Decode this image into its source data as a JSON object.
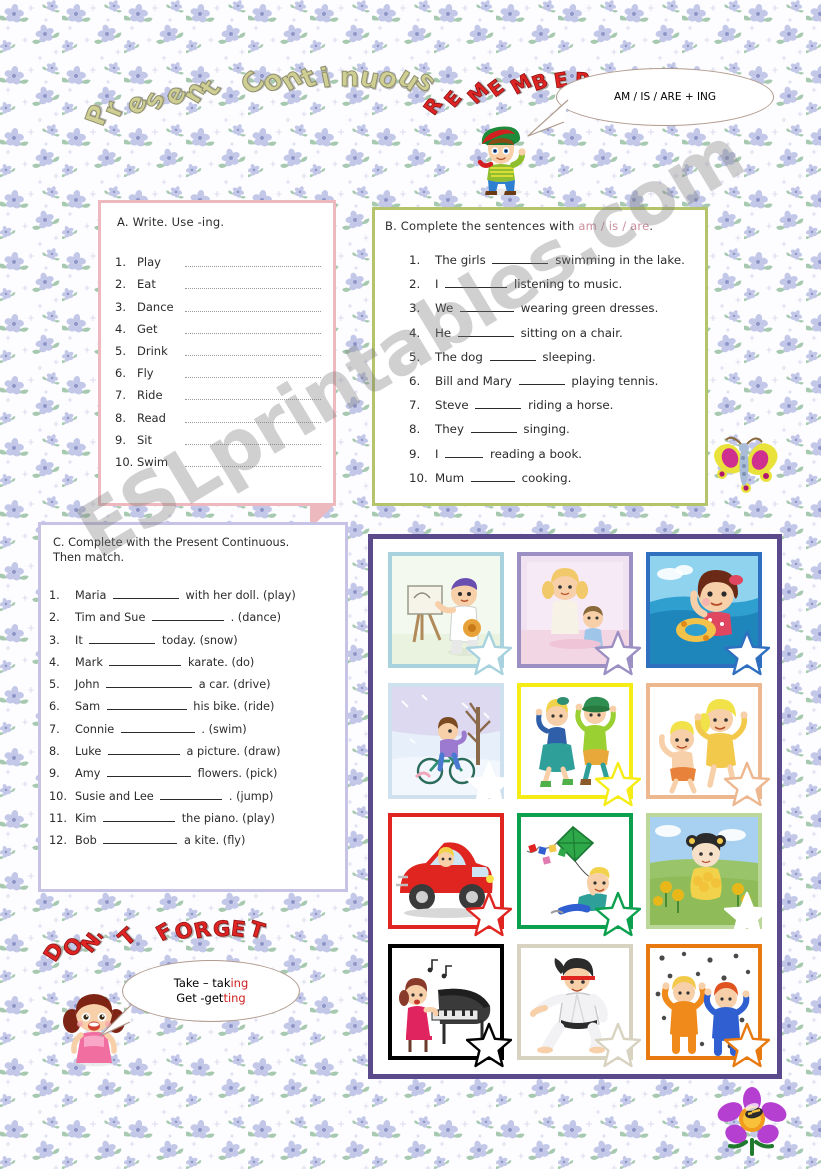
{
  "worksheet": {
    "title": "Present Continuous",
    "remember_title": "REMEMBER",
    "remember_rule": "AM / IS / ARE + ING",
    "forget_title": "DON'T FORGET",
    "forget_line1_a": "Take – tak",
    "forget_line1_b": "ing",
    "forget_line2_a": "Get -get",
    "forget_line2_b": "ting",
    "watermark": "ESLprintables.com"
  },
  "exercise_a": {
    "heading": "A.  Write. Use -ing.",
    "items": [
      {
        "num": "1.",
        "verb": "Play"
      },
      {
        "num": "2.",
        "verb": "Eat"
      },
      {
        "num": "3.",
        "verb": "Dance"
      },
      {
        "num": "4.",
        "verb": "Get"
      },
      {
        "num": "5.",
        "verb": "Drink"
      },
      {
        "num": "6.",
        "verb": "Fly"
      },
      {
        "num": "7.",
        "verb": "Ride"
      },
      {
        "num": "8.",
        "verb": "Read"
      },
      {
        "num": "9.",
        "verb": "Sit"
      },
      {
        "num": "10.",
        "verb": "Swim"
      }
    ]
  },
  "exercise_b": {
    "heading_before": "B. Complete the sentences with ",
    "heading_forms": "am / is / are",
    "heading_after": ".",
    "items": [
      {
        "num": "1.",
        "before": "The girls",
        "blank": 56,
        "after": "swimming in the lake."
      },
      {
        "num": "2.",
        "before": "I",
        "blank": 62,
        "after": "listening to music."
      },
      {
        "num": "3.",
        "before": "We",
        "blank": 54,
        "after": "wearing green dresses."
      },
      {
        "num": "4.",
        "before": "He",
        "blank": 56,
        "after": "sitting on a chair."
      },
      {
        "num": "5.",
        "before": "The dog",
        "blank": 46,
        "after": "sleeping."
      },
      {
        "num": "6.",
        "before": "Bill and Mary",
        "blank": 46,
        "after": "playing tennis."
      },
      {
        "num": "7.",
        "before": "Steve",
        "blank": 46,
        "after": "riding a horse."
      },
      {
        "num": "8.",
        "before": "They",
        "blank": 46,
        "after": "singing."
      },
      {
        "num": "9.",
        "before": "I",
        "blank": 38,
        "after": "reading a book."
      },
      {
        "num": "10.",
        "before": "Mum",
        "blank": 44,
        "after": "cooking."
      }
    ]
  },
  "exercise_c": {
    "heading_line1": "C. Complete with the Present Continuous.",
    "heading_line2": "Then match.",
    "items": [
      {
        "num": "1.",
        "before": "Maria",
        "blank": 66,
        "after": "with her doll. (play)"
      },
      {
        "num": "2.",
        "before": "Tim and Sue",
        "blank": 72,
        "after": ". (dance)"
      },
      {
        "num": "3.",
        "before": "It",
        "blank": 66,
        "after": "today. (snow)"
      },
      {
        "num": "4.",
        "before": "Mark",
        "blank": 72,
        "after": "karate. (do)"
      },
      {
        "num": "5.",
        "before": "John",
        "blank": 86,
        "after": "a car. (drive)"
      },
      {
        "num": "6.",
        "before": "Sam",
        "blank": 80,
        "after": "his bike. (ride)"
      },
      {
        "num": "7.",
        "before": "Connie",
        "blank": 74,
        "after": ". (swim)"
      },
      {
        "num": "8.",
        "before": "Luke",
        "blank": 72,
        "after": "a picture. (draw)"
      },
      {
        "num": "9.",
        "before": "Amy",
        "blank": 84,
        "after": "flowers. (pick)"
      },
      {
        "num": "10.",
        "before": "Susie and Lee",
        "blank": 62,
        "after": ". (jump)"
      },
      {
        "num": "11.",
        "before": "Kim",
        "blank": 72,
        "after": "the piano. (play)"
      },
      {
        "num": "12.",
        "before": "Bob",
        "blank": 74,
        "after": "a kite. (fly)"
      }
    ]
  },
  "pictures": [
    {
      "name": "boy-drawing-picture",
      "action": "drawing",
      "frame": "#a8d2de",
      "star": "#a8d2de"
    },
    {
      "name": "girls-playing-doll",
      "action": "playing with doll",
      "frame": "#9c8fc4",
      "star": "#9c8fc4"
    },
    {
      "name": "girl-swimming",
      "action": "swimming",
      "frame": "#2f6fc0",
      "star": "#2f6fc0"
    },
    {
      "name": "boy-riding-bike-snow",
      "action": "riding a bike",
      "frame": "#cfe0ef",
      "star": "#ffffff"
    },
    {
      "name": "children-dancing",
      "action": "dancing",
      "frame": "#f6ec15",
      "star": "#f6ec15"
    },
    {
      "name": "children-jumping",
      "action": "jumping",
      "frame": "#edb790",
      "star": "#edb790"
    },
    {
      "name": "woman-driving-car",
      "action": "driving a car",
      "frame": "#e0241f",
      "star": "#e0241f"
    },
    {
      "name": "boy-flying-kite",
      "action": "flying a kite",
      "frame": "#0ba04e",
      "star": "#0ba04e"
    },
    {
      "name": "girl-picking-flowers",
      "action": "picking flowers",
      "frame": "#bcd79a",
      "star": "#ffffff"
    },
    {
      "name": "girl-playing-piano",
      "action": "playing the piano",
      "frame": "#000000",
      "star": "#000000"
    },
    {
      "name": "boy-doing-karate",
      "action": "doing karate",
      "frame": "#d8d3c0",
      "star": "#d8d3c0"
    },
    {
      "name": "children-playing-snow",
      "action": "playing in the snow",
      "frame": "#e8790f",
      "star": "#e8790f"
    }
  ],
  "decorations": {
    "boy_icon": "boy-pointing-icon",
    "girl_icon": "girl-smiling-icon",
    "butterfly_icon": "butterfly-icon",
    "flower_icon": "flower-with-bee-icon"
  },
  "colors": {
    "panel_a_border": "#edb9bf",
    "panel_b_border": "#b3c46a",
    "panel_c_border": "#c6c3e6",
    "pictures_border": "#5a4a8c",
    "title_fill": "#cfcf93",
    "accent_red": "#e02424"
  }
}
